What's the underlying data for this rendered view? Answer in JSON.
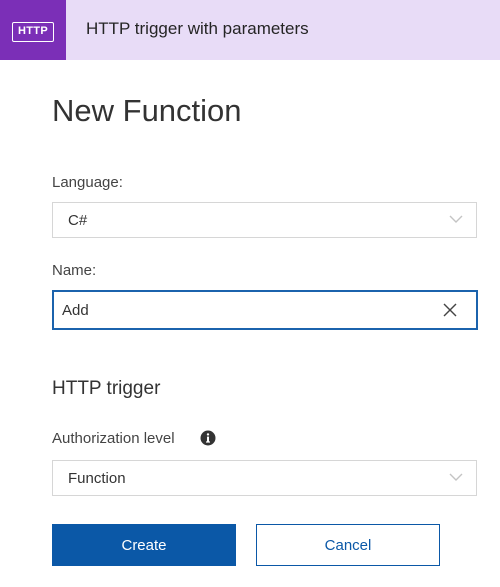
{
  "header": {
    "badge_text": "HTTP",
    "title": "HTTP trigger with parameters",
    "accent_color": "#7b2fb7",
    "background_color": "#e8dcf7"
  },
  "page": {
    "title": "New Function"
  },
  "form": {
    "language_label": "Language:",
    "language_value": "C#",
    "name_label": "Name:",
    "name_value": "Add",
    "section_title": "HTTP trigger",
    "auth_label": "Authorization level",
    "auth_value": "Function"
  },
  "icons": {
    "badge": "http-badge-icon",
    "dropdown": "chevron-down-icon",
    "clear": "close-icon",
    "info": "info-icon"
  },
  "actions": {
    "create_label": "Create",
    "cancel_label": "Cancel",
    "primary_color": "#0b58a7"
  }
}
